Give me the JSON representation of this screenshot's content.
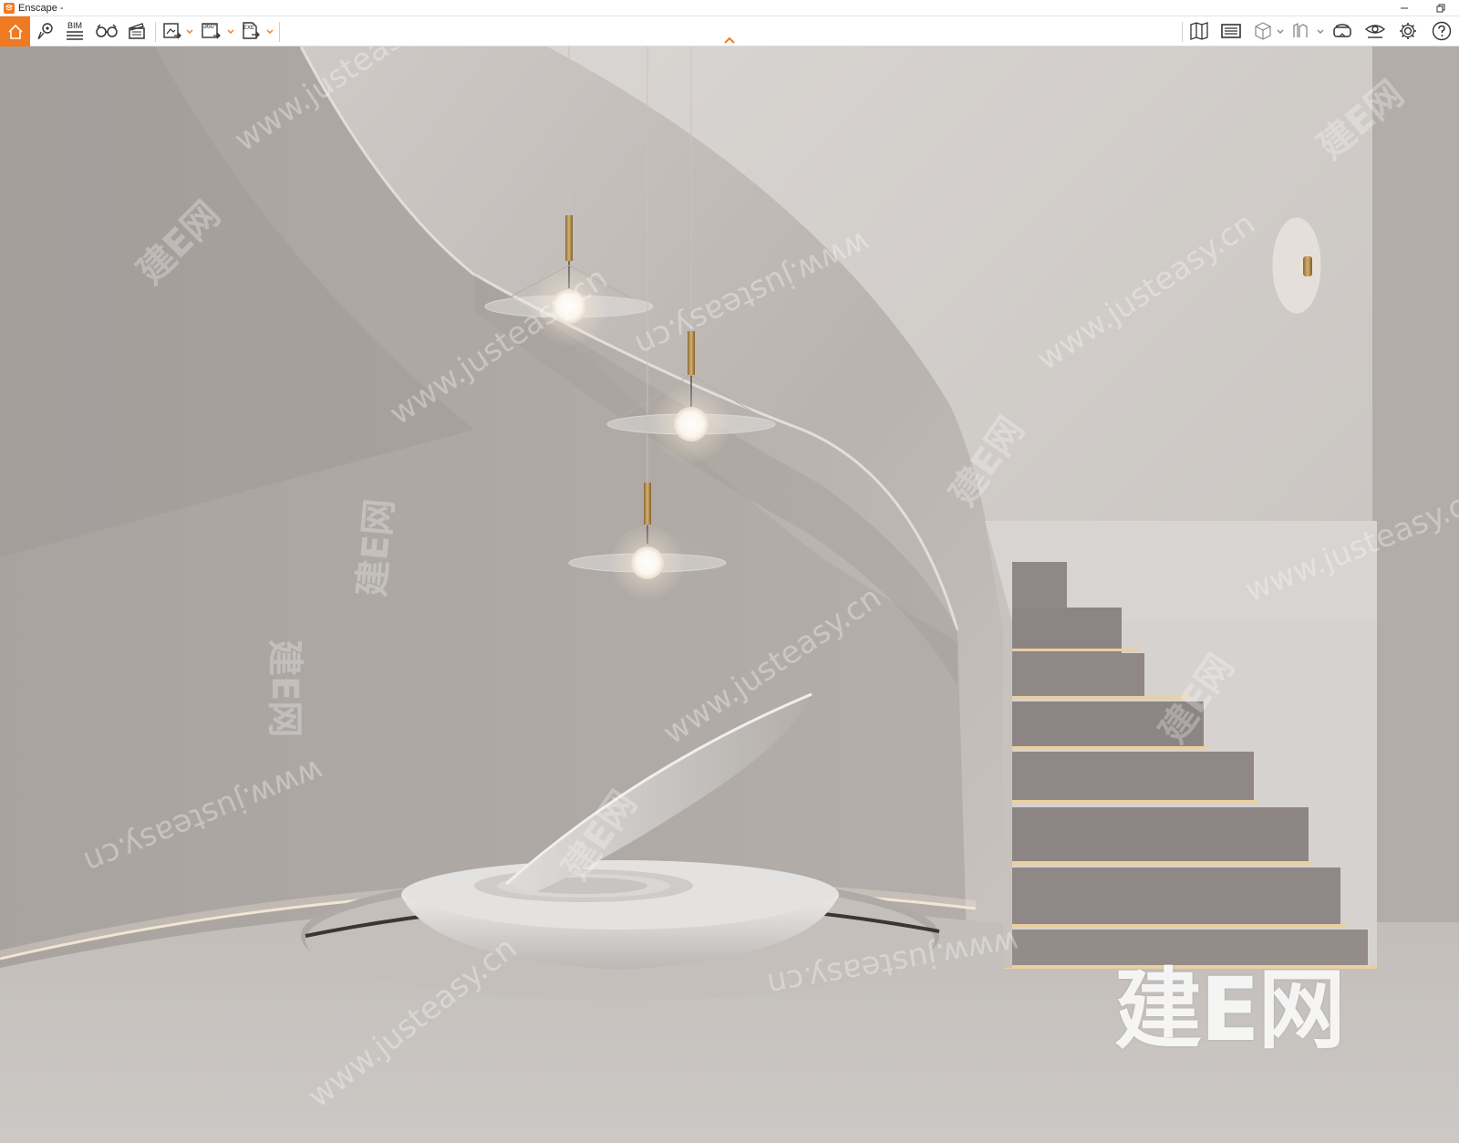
{
  "window": {
    "title": "Enscape -",
    "brand_color": "#f07a22",
    "controls": [
      "minimize-icon",
      "restore-icon"
    ]
  },
  "toolbar": {
    "left_items": [
      {
        "icon": "home-icon",
        "active": true
      },
      {
        "icon": "map-pin-search-icon"
      },
      {
        "icon": "bim-icon",
        "label": "BIM"
      },
      {
        "icon": "vr-goggles-icon"
      },
      {
        "icon": "clapperboard-icon"
      },
      {
        "icon": "screenshot-export-icon",
        "dropdown": true
      },
      {
        "icon": "panorama-360-export-icon",
        "label": "360°",
        "dropdown": true
      },
      {
        "icon": "exe-export-icon",
        "label": "EXE",
        "dropdown": true
      }
    ],
    "collapse_icon": "chevron-up-icon",
    "right_items": [
      {
        "icon": "map-icon"
      },
      {
        "icon": "timeline-icon"
      },
      {
        "icon": "cube-view-icon",
        "dropdown": true
      },
      {
        "icon": "asset-library-icon",
        "dropdown": true
      },
      {
        "icon": "vr-headset-icon"
      },
      {
        "icon": "visual-settings-eye-icon"
      },
      {
        "icon": "settings-gear-icon"
      },
      {
        "icon": "help-icon"
      }
    ]
  },
  "viewport": {
    "scene": "spiral staircase interior rendering with three glass pendant lamps and a shell sculpture",
    "watermark_url": "www.justeasy.cn",
    "watermark_cn": "建E网",
    "corner_logo": "建E网"
  }
}
